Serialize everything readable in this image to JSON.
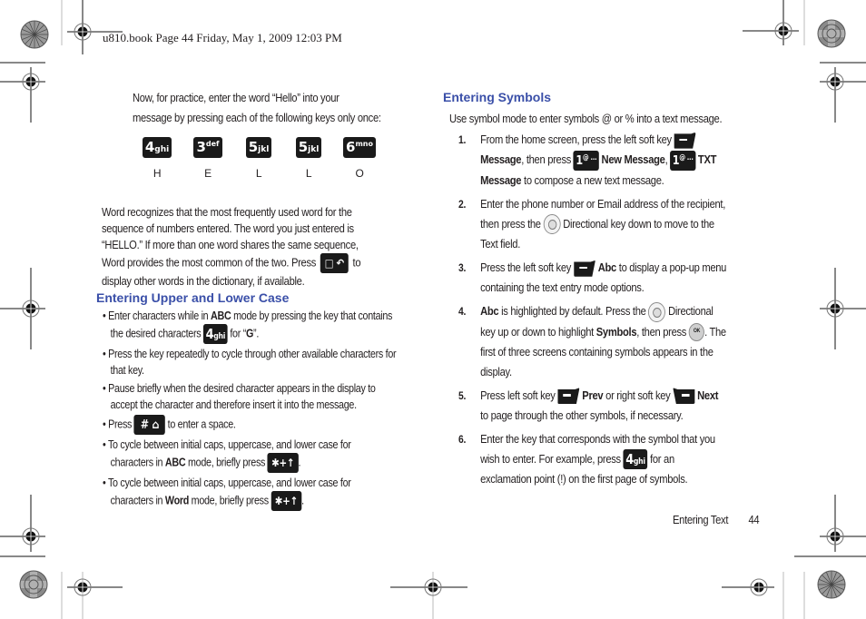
{
  "header": {
    "slug": "u810.book  Page 44  Friday, May 1, 2009  12:03 PM"
  },
  "left": {
    "intro": [
      "Now, for practice, enter the word “Hello” into your",
      "message by pressing each of the following keys only once:"
    ],
    "keys": [
      {
        "digit": "4",
        "letters": "ghi",
        "char": "H"
      },
      {
        "digit": "3",
        "letters": "def",
        "char": "E"
      },
      {
        "digit": "5",
        "letters": "jkl",
        "char": "L"
      },
      {
        "digit": "5",
        "letters": "jkl",
        "char": "L"
      },
      {
        "digit": "6",
        "letters": "mno",
        "char": "O"
      }
    ],
    "word_para": [
      "Word recognizes that the most frequently used word for the",
      "sequence of numbers entered. The word you just entered is",
      "“HELLO.” If more than one word shares the same sequence,",
      "Word provides the most common of the two. Press",
      "to",
      "display other words in the dictionary, if available."
    ],
    "section_title": "Entering Upper and Lower Case",
    "bullets": {
      "b1_l1_pre": "Enter characters while in ",
      "b1_l1_bold": "ABC",
      "b1_l1_post": " mode by pressing the key that contains",
      "b1_l2_pre": "the desired characters",
      "b1_l2_post_pre": " for “",
      "b1_l2_bold": "G",
      "b1_l2_post": "”.",
      "b2_l1": "Press the key repeatedly to cycle through other available characters for",
      "b2_l2": "that key.",
      "b3_l1": "Pause briefly when the desired character appears in the display to",
      "b3_l2": "accept the character and therefore insert it into the message.",
      "b4_pre": "Press",
      "b4_post": "to enter a space.",
      "b5_l1": "To cycle between initial caps, uppercase, and lower case for",
      "b5_l2_pre": "characters in ",
      "b5_l2_bold": "ABC",
      "b5_l2_post": " mode, briefly press",
      "b6_l1": "To cycle between initial caps, uppercase, and lower case for",
      "b6_l2_pre": "characters in ",
      "b6_l2_bold": "Word",
      "b6_l2_post": " mode, briefly press",
      "period": "."
    },
    "key_4ghi": {
      "digit": "4",
      "letters": "ghi"
    },
    "key_star": "✱+↑",
    "key_hash": "#",
    "key_back": "□ ↶"
  },
  "right": {
    "section_title": "Entering Symbols",
    "intro": "Use symbol mode to enter symbols @ or % into a text message.",
    "steps": [
      {
        "num": "1.",
        "l1": "From the home screen, press the left soft key",
        "l2_bold1": "Message",
        "l2_mid": ", then press",
        "l2_bold2": "New Message",
        "l2_comma": ",",
        "l2_bold3": "TXT",
        "l3_bold": "Message",
        "l3_post": " to compose a new text message."
      },
      {
        "num": "2.",
        "l1": "Enter the phone number or Email address of the recipient,",
        "l2_pre": "then press the",
        "l2_post": "Directional key down to move to the",
        "l3": "Text field."
      },
      {
        "num": "3.",
        "l1_pre": "Press the left soft key",
        "l1_bold": "Abc",
        "l1_post": " to display a pop-up menu",
        "l2": "containing the text entry mode options."
      },
      {
        "num": "4.",
        "l1_bold": "Abc",
        "l1_mid": " is highlighted by default. Press the",
        "l1_post": "Directional",
        "l2_pre": "key up or down to highlight ",
        "l2_bold": "Symbols",
        "l2_mid": ", then press",
        "l2_post": ". The",
        "l3": "first of three screens containing symbols appears in the",
        "l4": "display."
      },
      {
        "num": "5.",
        "l1_pre": "Press left soft key",
        "l1_bold1": "Prev",
        "l1_mid": " or right soft key",
        "l1_bold2": "Next",
        "l2": "to page through the other symbols, if necessary."
      },
      {
        "num": "6.",
        "l1": "Enter the key that corresponds with the symbol that you",
        "l2_pre": "wish to enter. For example, press",
        "l2_post": "for an",
        "l3": "exclamation point (!) on the first page of symbols."
      }
    ],
    "key_1": {
      "digit": "1",
      "letters": "@ …"
    },
    "ok_label": "OK"
  },
  "footer": {
    "section": "Entering Text",
    "page": "44"
  },
  "colors": {
    "heading": "#3a4fa8",
    "text": "#231f20",
    "key_bg": "#1a1a1a"
  }
}
